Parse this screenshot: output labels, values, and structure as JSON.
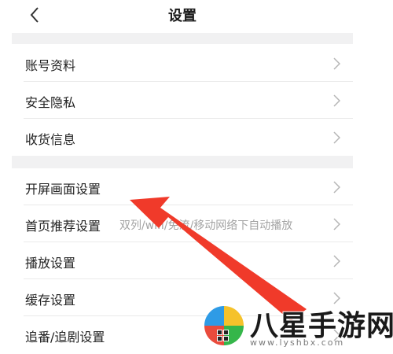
{
  "header": {
    "title": "设置"
  },
  "settings": {
    "group1": [
      {
        "label": "账号资料"
      },
      {
        "label": "安全隐私"
      },
      {
        "label": "收货信息"
      }
    ],
    "group2": [
      {
        "label": "开屏画面设置"
      },
      {
        "label": "首页推荐设置",
        "value": "双列/wifi/免流/移动网络下自动播放"
      },
      {
        "label": "播放设置"
      },
      {
        "label": "缓存设置"
      },
      {
        "label": "追番/追剧设置"
      }
    ]
  },
  "annotation": {
    "arrow_color": "#f03a2a"
  },
  "watermark": {
    "brand": "八星手游网",
    "url": "www.lyshbx.com"
  },
  "colors": {
    "section_gap": "#f1f1f2",
    "divider": "#eaeaea",
    "secondary_text": "#a3a3a3",
    "chevron": "#b5b5b5"
  }
}
